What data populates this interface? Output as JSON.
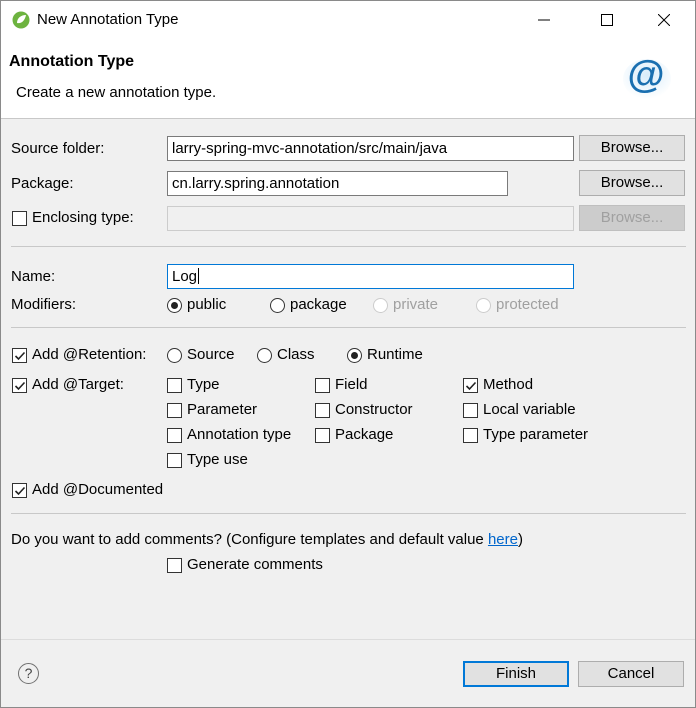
{
  "window": {
    "title": "New Annotation Type"
  },
  "banner": {
    "title": "Annotation Type",
    "description": "Create a new annotation type."
  },
  "source_folder": {
    "label": "Source folder:",
    "value": "larry-spring-mvc-annotation/src/main/java",
    "browse": "Browse..."
  },
  "package": {
    "label": "Package:",
    "value": "cn.larry.spring.annotation",
    "browse": "Browse..."
  },
  "enclosing": {
    "label": "Enclosing type:",
    "value": "",
    "browse": "Browse...",
    "checked": false
  },
  "name": {
    "label": "Name:",
    "value": "Log"
  },
  "modifiers": {
    "label": "Modifiers:",
    "options": [
      "public",
      "package",
      "private",
      "protected"
    ],
    "selected": "public"
  },
  "retention": {
    "label": "Add @Retention:",
    "checked": true,
    "options": [
      "Source",
      "Class",
      "Runtime"
    ],
    "selected": "Runtime"
  },
  "target": {
    "label": "Add @Target:",
    "checked": true,
    "options": {
      "type": "Type",
      "field": "Field",
      "method": "Method",
      "parameter": "Parameter",
      "constructor": "Constructor",
      "local_variable": "Local variable",
      "annotation_type": "Annotation type",
      "package": "Package",
      "type_parameter": "Type parameter",
      "type_use": "Type use"
    },
    "selected": [
      "Method"
    ]
  },
  "documented": {
    "label": "Add @Documented",
    "checked": true
  },
  "comments": {
    "question": "Do you want to add comments? (Configure templates and default value ",
    "link": "here",
    "suffix": ")",
    "generate_label": "Generate comments",
    "generate_checked": false
  },
  "footer": {
    "help": "?",
    "finish": "Finish",
    "cancel": "Cancel"
  },
  "colors": {
    "accent": "#0078d7",
    "link": "#0066cc",
    "logo": "#1a6fb0"
  }
}
